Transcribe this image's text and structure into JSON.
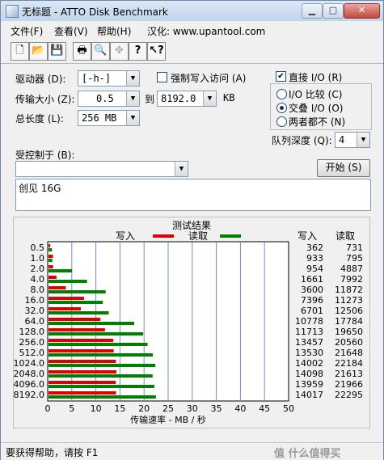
{
  "window": {
    "title": "无标题 - ATTO Disk Benchmark",
    "minimize": "▁",
    "maximize": "□",
    "close": "✕"
  },
  "menu": [
    "文件(F)",
    "查看(V)",
    "帮助(H)",
    "汉化: www.upantool.com"
  ],
  "toolbar": {
    "icons": [
      "new-file-icon",
      "open-folder-icon",
      "save-icon",
      "print-icon",
      "print-preview-icon",
      "move-icon",
      "help-icon",
      "context-help-icon"
    ]
  },
  "settings": {
    "drive_label": "驱动器 (D):",
    "drive_value": "[-h-]",
    "transfer_label": "传输大小 (Z):",
    "transfer_from": "0.5",
    "transfer_to_label": "到",
    "transfer_to": "8192.0",
    "transfer_unit": "KB",
    "length_label": "总长度 (L):",
    "length_value": "256 MB",
    "force_write_label": "强制写入访问 (A)",
    "force_write_checked": false,
    "direct_io_label": "直接 I/O (R)",
    "direct_io_checked": true,
    "io_compare_label": "I/O 比较 (C)",
    "overlapped_io_label": "交叠 I/O (O)",
    "neither_label": "两者都不 (N)",
    "io_mode_selected": "交叠 I/O (O)",
    "queue_label": "队列深度 (Q):",
    "queue_value": "4",
    "controlled_by_label": "受控制于 (B):",
    "controlled_by_value": "",
    "start_button": "开始 (S)",
    "description": "创见 16G"
  },
  "results": {
    "title": "测试结果",
    "write_legend": "写入",
    "read_legend": "读取",
    "write_col": "写入",
    "read_col": "读取",
    "write_color": "#e00000",
    "read_color": "#008000"
  },
  "chart_data": {
    "type": "bar",
    "orientation": "horizontal",
    "categories": [
      "0.5",
      "1.0",
      "2.0",
      "4.0",
      "8.0",
      "16.0",
      "32.0",
      "64.0",
      "128.0",
      "256.0",
      "512.0",
      "1024.0",
      "2048.0",
      "4096.0",
      "8192.0"
    ],
    "series": [
      {
        "name": "写入",
        "values": [
          362,
          933,
          954,
          1661,
          3600,
          7396,
          6701,
          10778,
          11713,
          13457,
          13530,
          14002,
          14098,
          13959,
          14017
        ]
      },
      {
        "name": "读取",
        "values": [
          731,
          795,
          4887,
          7992,
          11872,
          11273,
          12506,
          17784,
          19650,
          20560,
          21648,
          22184,
          21613,
          21966,
          22295
        ]
      }
    ],
    "x_ticks": [
      "0",
      "5",
      "10",
      "15",
      "20",
      "25",
      "30",
      "35",
      "40",
      "45",
      "50"
    ],
    "xlim": [
      0,
      50
    ],
    "xlabel": "传输速率 - MB / 秒",
    "grid": true,
    "legend": "top"
  },
  "status": {
    "text": "要获得帮助，请按 F1",
    "watermark": "值 什么值得买"
  }
}
